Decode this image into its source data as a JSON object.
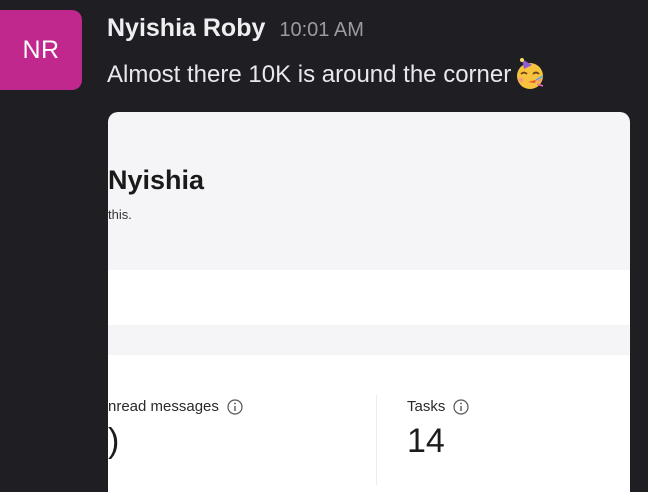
{
  "message": {
    "avatar_initials": "NR",
    "author": "Nyishia Roby",
    "time": "10:01 AM",
    "text": "Almost there 10K is around the corner",
    "emoji_icon": "partying-face-emoji-icon"
  },
  "card": {
    "name": "Nyishia",
    "subtitle": "this.",
    "stats": [
      {
        "label": "nread messages",
        "value": ")",
        "icon": "info-icon"
      },
      {
        "label": "Tasks",
        "value": "14",
        "icon": "info-icon"
      }
    ]
  },
  "colors": {
    "background": "#1f1e23",
    "avatar": "#c0288e",
    "card": "#f5f5f7"
  }
}
